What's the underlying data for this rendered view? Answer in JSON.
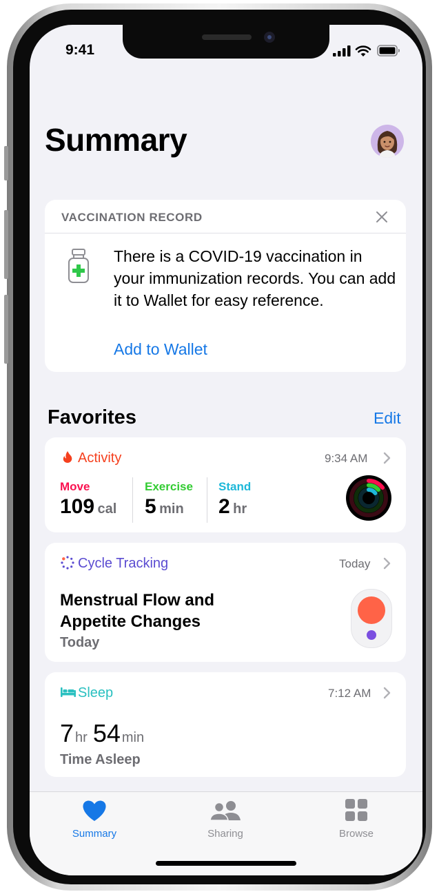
{
  "status_bar": {
    "time": "9:41"
  },
  "header": {
    "title": "Summary"
  },
  "vaccination_card": {
    "header": "VACCINATION RECORD",
    "body": "There is a COVID-19 vaccination in your immunization records. You can add it to Wallet for easy reference.",
    "link": "Add to Wallet"
  },
  "favorites": {
    "title": "Favorites",
    "edit_label": "Edit",
    "activity": {
      "label": "Activity",
      "time": "9:34 AM",
      "move": {
        "label": "Move",
        "value": "109",
        "unit": "cal",
        "color": "#fa114f"
      },
      "exercise": {
        "label": "Exercise",
        "value": "5",
        "unit": "min",
        "color": "#33cc33"
      },
      "stand": {
        "label": "Stand",
        "value": "2",
        "unit": "hr",
        "color": "#1eb8d9"
      }
    },
    "cycle": {
      "label": "Cycle Tracking",
      "time": "Today",
      "title": "Menstrual Flow and Appetite Changes",
      "subtitle": "Today"
    },
    "sleep": {
      "label": "Sleep",
      "time": "7:12 AM",
      "hours": "7",
      "hours_unit": "hr",
      "minutes": "54",
      "minutes_unit": "min",
      "caption": "Time Asleep"
    }
  },
  "tabbar": {
    "tabs": [
      {
        "label": "Summary",
        "active": true
      },
      {
        "label": "Sharing",
        "active": false
      },
      {
        "label": "Browse",
        "active": false
      }
    ]
  },
  "colors": {
    "accent": "#1678e6",
    "activity": "#f5401e",
    "cycle": "#5a4bd1",
    "sleep": "#2ac0c0"
  }
}
